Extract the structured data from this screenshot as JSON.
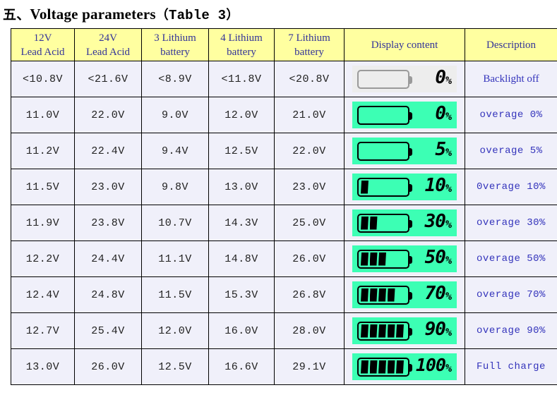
{
  "title": {
    "section": "五、",
    "text": "Voltage parameters",
    "paren_open": "（",
    "table_ref": "Table 3",
    "paren_close": "）"
  },
  "table": {
    "headers": [
      {
        "line1": "12V",
        "line2": "Lead Acid"
      },
      {
        "line1": "24V",
        "line2": "Lead Acid"
      },
      {
        "line1": "3 Lithium",
        "line2": "battery"
      },
      {
        "line1": "4 Lithium",
        "line2": "battery"
      },
      {
        "line1": "7 Lithium",
        "line2": "battery"
      },
      {
        "line1": "Display content",
        "line2": ""
      },
      {
        "line1": "Description",
        "line2": ""
      }
    ],
    "rows": [
      {
        "v12": "<10.8V",
        "v24": "<21.6V",
        "li3": "<8.9V",
        "li4": "<11.8V",
        "li7": "<20.8V",
        "display": {
          "bars": 0,
          "percent": "0",
          "backlight": false
        },
        "description": "Backlight off",
        "desc_style": "serif"
      },
      {
        "v12": "11.0V",
        "v24": "22.0V",
        "li3": "9.0V",
        "li4": "12.0V",
        "li7": "21.0V",
        "display": {
          "bars": 0,
          "percent": "0",
          "backlight": true
        },
        "description": "overage 0%",
        "desc_style": "mono"
      },
      {
        "v12": "11.2V",
        "v24": "22.4V",
        "li3": "9.4V",
        "li4": "12.5V",
        "li7": "22.0V",
        "display": {
          "bars": 0,
          "percent": "5",
          "backlight": true
        },
        "description": "overage 5%",
        "desc_style": "mono"
      },
      {
        "v12": "11.5V",
        "v24": "23.0V",
        "li3": "9.8V",
        "li4": "13.0V",
        "li7": "23.0V",
        "display": {
          "bars": 1,
          "percent": "10",
          "backlight": true
        },
        "description": "0verage 10%",
        "desc_style": "mono"
      },
      {
        "v12": "11.9V",
        "v24": "23.8V",
        "li3": "10.7V",
        "li4": "14.3V",
        "li7": "25.0V",
        "display": {
          "bars": 2,
          "percent": "30",
          "backlight": true
        },
        "description": "overage 30%",
        "desc_style": "mono"
      },
      {
        "v12": "12.2V",
        "v24": "24.4V",
        "li3": "11.1V",
        "li4": "14.8V",
        "li7": "26.0V",
        "display": {
          "bars": 3,
          "percent": "50",
          "backlight": true
        },
        "description": "overage 50%",
        "desc_style": "mono"
      },
      {
        "v12": "12.4V",
        "v24": "24.8V",
        "li3": "11.5V",
        "li4": "15.3V",
        "li7": "26.8V",
        "display": {
          "bars": 4,
          "percent": "70",
          "backlight": true
        },
        "description": "overage 70%",
        "desc_style": "mono"
      },
      {
        "v12": "12.7V",
        "v24": "25.4V",
        "li3": "12.0V",
        "li4": "16.0V",
        "li7": "28.0V",
        "display": {
          "bars": 5,
          "percent": "90",
          "backlight": true
        },
        "description": "overage 90%",
        "desc_style": "mono"
      },
      {
        "v12": "13.0V",
        "v24": "26.0V",
        "li3": "12.5V",
        "li4": "16.6V",
        "li7": "29.1V",
        "display": {
          "bars": 5,
          "percent": "100",
          "backlight": true
        },
        "description": "Full charge",
        "desc_style": "mono"
      }
    ]
  },
  "colors": {
    "header_bg": "#ffffa0",
    "header_text": "#333399",
    "cell_bg": "#f0f0fa",
    "cell_text": "#222222",
    "desc_text": "#3333bb",
    "lcd_on": "#3cffb4",
    "lcd_off": "#ededed",
    "segment": "#000000",
    "border": "#000000"
  },
  "units": {
    "percent_symbol": "%"
  }
}
